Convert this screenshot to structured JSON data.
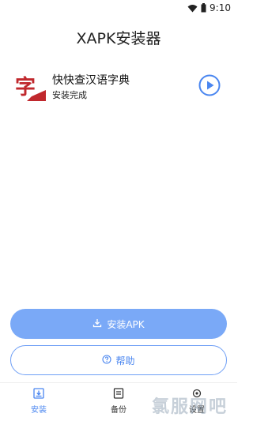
{
  "status_bar": {
    "time": "9:10"
  },
  "header": {
    "title": "XAPK安装器"
  },
  "app_item": {
    "icon_text": "字",
    "name": "快快查汉语字典",
    "status": "安装完成"
  },
  "actions": {
    "install_label": "安装APK",
    "help_label": "帮助"
  },
  "bottom_nav": {
    "items": [
      {
        "label": "安装"
      },
      {
        "label": "备份"
      },
      {
        "label": "设置"
      }
    ]
  },
  "watermark": {
    "text": "氯服网吧"
  },
  "colors": {
    "accent": "#4a86f0",
    "button_fill": "#7aa9f7"
  }
}
